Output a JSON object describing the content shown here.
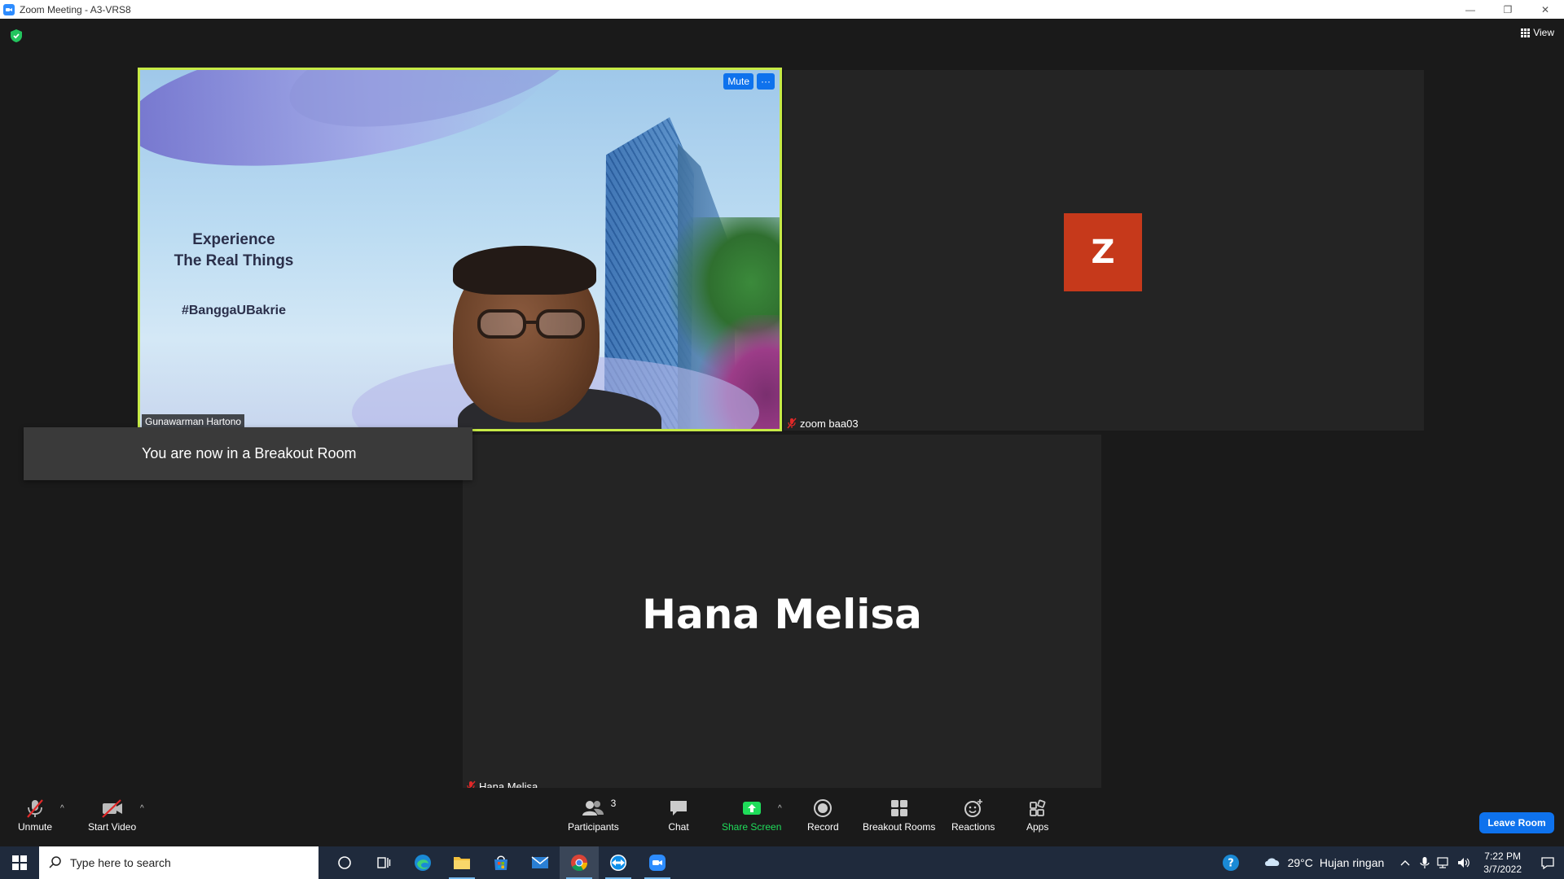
{
  "window": {
    "title": "Zoom Meeting - A3-VRS8",
    "controls": [
      "—",
      "❐",
      "✕"
    ]
  },
  "meeting": {
    "view_label": "View",
    "toast": "You are now in a Breakout Room",
    "tiles": [
      {
        "name": "Gunawarman Hartono",
        "mute_button": "Mute",
        "more_button": "···",
        "slide_headline_line1": "Experience",
        "slide_headline_line2": "The Real Things",
        "slide_hashtag": "#BanggaUBakrie",
        "active_speaker_color": "#c6ea46"
      },
      {
        "name": "zoom baa03",
        "avatar_letter": "Z",
        "avatar_color": "#c6391b",
        "muted": true
      },
      {
        "name": "Hana Melisa",
        "display_name_large": "Hana Melisa",
        "muted": true
      }
    ]
  },
  "toolbar": {
    "unmute": "Unmute",
    "start_video": "Start Video",
    "participants": "Participants",
    "participants_count": "3",
    "chat": "Chat",
    "share_screen": "Share Screen",
    "record": "Record",
    "breakout_rooms": "Breakout Rooms",
    "reactions": "Reactions",
    "apps": "Apps",
    "leave": "Leave Room",
    "share_color": "#1fdc5a",
    "leave_color": "#0e72ed"
  },
  "taskbar": {
    "search_placeholder": "Type here to search",
    "weather_temp": "29°C",
    "weather_desc": "Hujan ringan",
    "time": "7:22 PM",
    "date": "3/7/2022",
    "icons": [
      "cortana-icon",
      "task-view-icon",
      "edge-icon",
      "file-explorer-icon",
      "store-icon",
      "mail-icon",
      "chrome-icon",
      "teamviewer-icon",
      "zoom-icon"
    ]
  }
}
